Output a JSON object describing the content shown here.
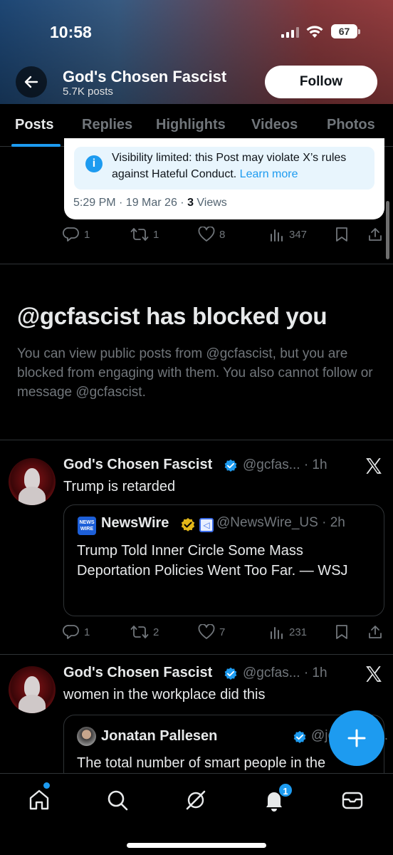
{
  "status_bar": {
    "time": "10:58",
    "battery": "67"
  },
  "header": {
    "profile_name": "God's Chosen Fascist",
    "post_count": "5.7K posts",
    "follow_label": "Follow"
  },
  "tabs": [
    {
      "label": "Posts",
      "active": true
    },
    {
      "label": "Replies"
    },
    {
      "label": "Highlights"
    },
    {
      "label": "Videos"
    },
    {
      "label": "Photos"
    }
  ],
  "limited_post": {
    "notice_text": "Visibility limited: this Post may violate X’s rules against Hateful Conduct.",
    "learn_more": "Learn more",
    "timestamp": "5:29 PM · 19 Mar 26 · ",
    "views_count": "3",
    "views_label": " Views",
    "actions": {
      "replies": "1",
      "reposts": "1",
      "likes": "8",
      "views": "347"
    }
  },
  "blocked": {
    "title": "@gcfascist has blocked you",
    "description": "You can view public posts from @gcfascist, but you are blocked from engaging with them. You also cannot follow or message @gcfascist."
  },
  "tweets": [
    {
      "author": "God's Chosen Fascist",
      "handle_time": "@gcfas... · 1h",
      "text": "Trump is retarded",
      "quote": {
        "logo_text": "NEWS WIRE",
        "name": "NewsWire",
        "handle_time": "@NewsWire_US · 2h",
        "text": "Trump Told Inner Circle Some Mass Deportation Policies Went Too Far. — WSJ"
      },
      "actions": {
        "replies": "1",
        "reposts": "2",
        "likes": "7",
        "views": "231"
      }
    },
    {
      "author": "God's Chosen Fascist",
      "handle_time": "@gcfas... · 1h",
      "text": "women in the workplace did this",
      "quote": {
        "name": "Jonatan Pallesen",
        "handle_time": "@jonatanp...",
        "text": "The total number of smart people in the"
      }
    }
  ],
  "bottom_nav": {
    "notification_count": "1"
  },
  "colors": {
    "accent": "#1d9bf0",
    "background": "#000000",
    "muted": "#71767b"
  }
}
